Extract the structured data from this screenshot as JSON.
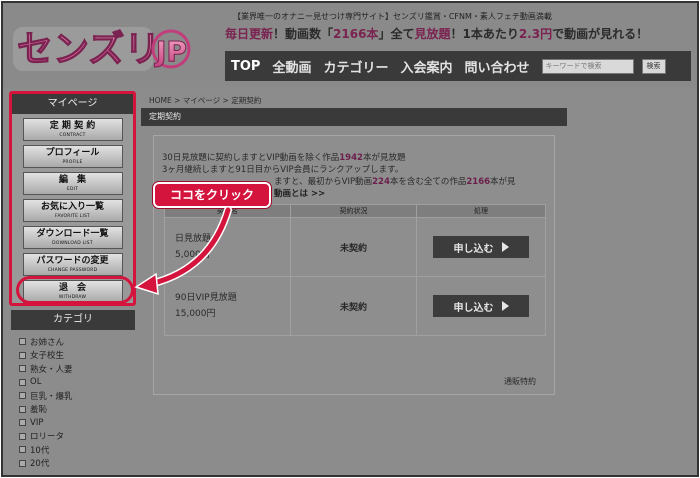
{
  "header": {
    "logo_text": "センズリ",
    "logo_jp": "JP",
    "tagline": "【業界唯一のオナニー見せつけ専門サイト】センズリ鑑賞・CFNM・素人フェチ動画満載",
    "headline": {
      "p1": "毎日更新",
      "p2": "！動画数「",
      "count": "2166本",
      "p3": "」全て",
      "p4": "見放題",
      "p5": "！1本あたり",
      "price": "2.3円",
      "p6": "で動画が見れる！"
    }
  },
  "nav": {
    "items": [
      "TOP",
      "全動画",
      "カテゴリー",
      "入会案内",
      "問い合わせ"
    ],
    "search_placeholder": "キーワードで検索",
    "search_button": "検索"
  },
  "sidebar": {
    "mypage_title": "マイページ",
    "buttons": [
      {
        "jp": "定 期 契 約",
        "en": "CONTRACT"
      },
      {
        "jp": "プロフィール",
        "en": "PROFILE"
      },
      {
        "jp": "編　集",
        "en": "EDIT"
      },
      {
        "jp": "お気に入り一覧",
        "en": "FAVORITE LIST"
      },
      {
        "jp": "ダウンロード一覧",
        "en": "DOWNLOAD LIST"
      },
      {
        "jp": "パスワードの変更",
        "en": "CHANGE PASSWORD"
      },
      {
        "jp": "退　会",
        "en": "WITHDRAW"
      }
    ],
    "category_title": "カテゴリ",
    "categories": [
      "お姉さん",
      "女子校生",
      "熟女・人妻",
      "OL",
      "巨乳・爆乳",
      "羞恥",
      "VIP",
      "ロリータ",
      "10代",
      "20代"
    ]
  },
  "main": {
    "breadcrumb": "HOME >  マイページ >  定期契約",
    "panel_title": "定期契約",
    "desc": {
      "line1_a": "30日見放題に契約しますとVIP動画を除く作品",
      "line1_count": "1942",
      "line1_b": "本が見放題",
      "line2": "3ヶ月継続しますと91日目からVIP会員にランクアップします。",
      "line3_a": "ますと、最初からVIP動画",
      "line3_count": "224",
      "line3_b": "本を含む全ての作品",
      "line3_count2": "2166",
      "line3_c": "本が見",
      "line4": "動画とは >>"
    },
    "table": {
      "headers": [
        "契約名",
        "契約状況",
        "処理"
      ],
      "rows": [
        {
          "name": "日見放題",
          "price": "5,000円",
          "status": "未契約",
          "button": "申し込む"
        },
        {
          "name": "90日VIP見放題",
          "price": "15,000円",
          "status": "未契約",
          "button": "申し込む"
        }
      ]
    },
    "law_link": "通販特約"
  },
  "callout": {
    "text": "ココをクリック"
  },
  "colors": {
    "accent_red": "#d4143d",
    "logo_pink": "#d65a92",
    "nav_dark": "#3a3a3a"
  }
}
